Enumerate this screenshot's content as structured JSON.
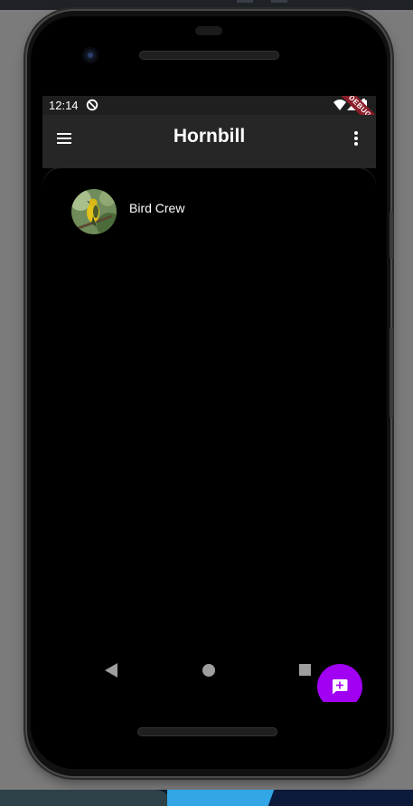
{
  "status_bar": {
    "time": "12:14",
    "debug_banner": "DEBUG",
    "icons": [
      "sync-icon",
      "wifi-icon",
      "cellular-icon",
      "battery-icon"
    ]
  },
  "app_bar": {
    "title": "Hornbill",
    "leading_icon": "menu-icon",
    "trailing_icon": "more-vert-icon"
  },
  "conversations": [
    {
      "name": "Bird Crew",
      "avatar": "bird-photo"
    }
  ],
  "fab": {
    "icon": "add-chat-icon"
  },
  "nav_bar": {
    "icons": [
      "back-icon",
      "home-icon",
      "recents-icon"
    ]
  },
  "colors": {
    "app_bar": "#262626",
    "status_bar": "#1f1f1f",
    "background": "#000000",
    "fab": "#a100f2",
    "text": "#ffffff",
    "debug_banner": "#8b1e2a"
  }
}
